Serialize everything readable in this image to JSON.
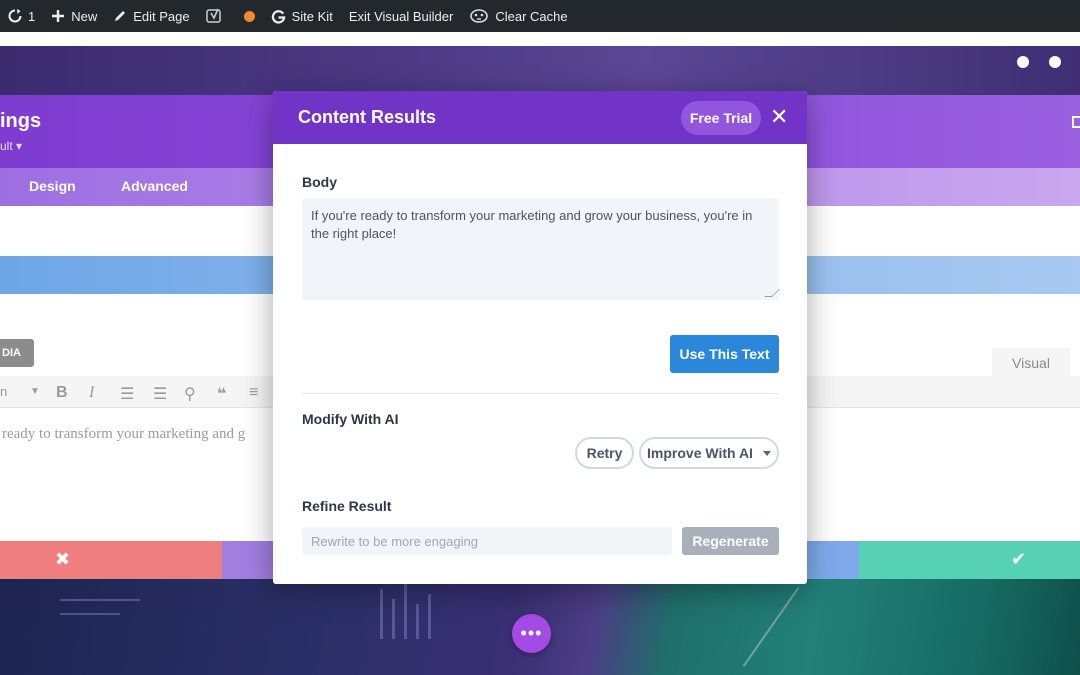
{
  "adminbar": {
    "updates_count": "1",
    "new_label": "New",
    "edit_page_label": "Edit Page",
    "site_kit_label": "Site Kit",
    "exit_builder_label": "Exit Visual Builder",
    "clear_cache_label": "Clear Cache",
    "status_dot_color": "#f18930"
  },
  "settings": {
    "title": "ings",
    "subtitle": "ult ▾",
    "tabs": [
      {
        "label": "Design"
      },
      {
        "label": "Advanced"
      }
    ],
    "media_label": "DIA",
    "visual_tab": "Visual",
    "editor_text": "ready to transform your marketing and g"
  },
  "modal": {
    "title": "Content Results",
    "free_trial_label": "Free Trial",
    "close_symbol": "✕",
    "body_label": "Body",
    "body_text": "If you're ready to transform your marketing and grow your business, you're in the right place!",
    "use_text_label": "Use This Text",
    "modify_label": "Modify With AI",
    "retry_label": "Retry",
    "improve_label": "Improve With AI",
    "refine_label": "Refine Result",
    "refine_placeholder": "Rewrite to be more engaging",
    "regenerate_label": "Regenerate",
    "header_color": "#7233c7",
    "primary_color": "#2b87da"
  },
  "fab_label": "•••"
}
